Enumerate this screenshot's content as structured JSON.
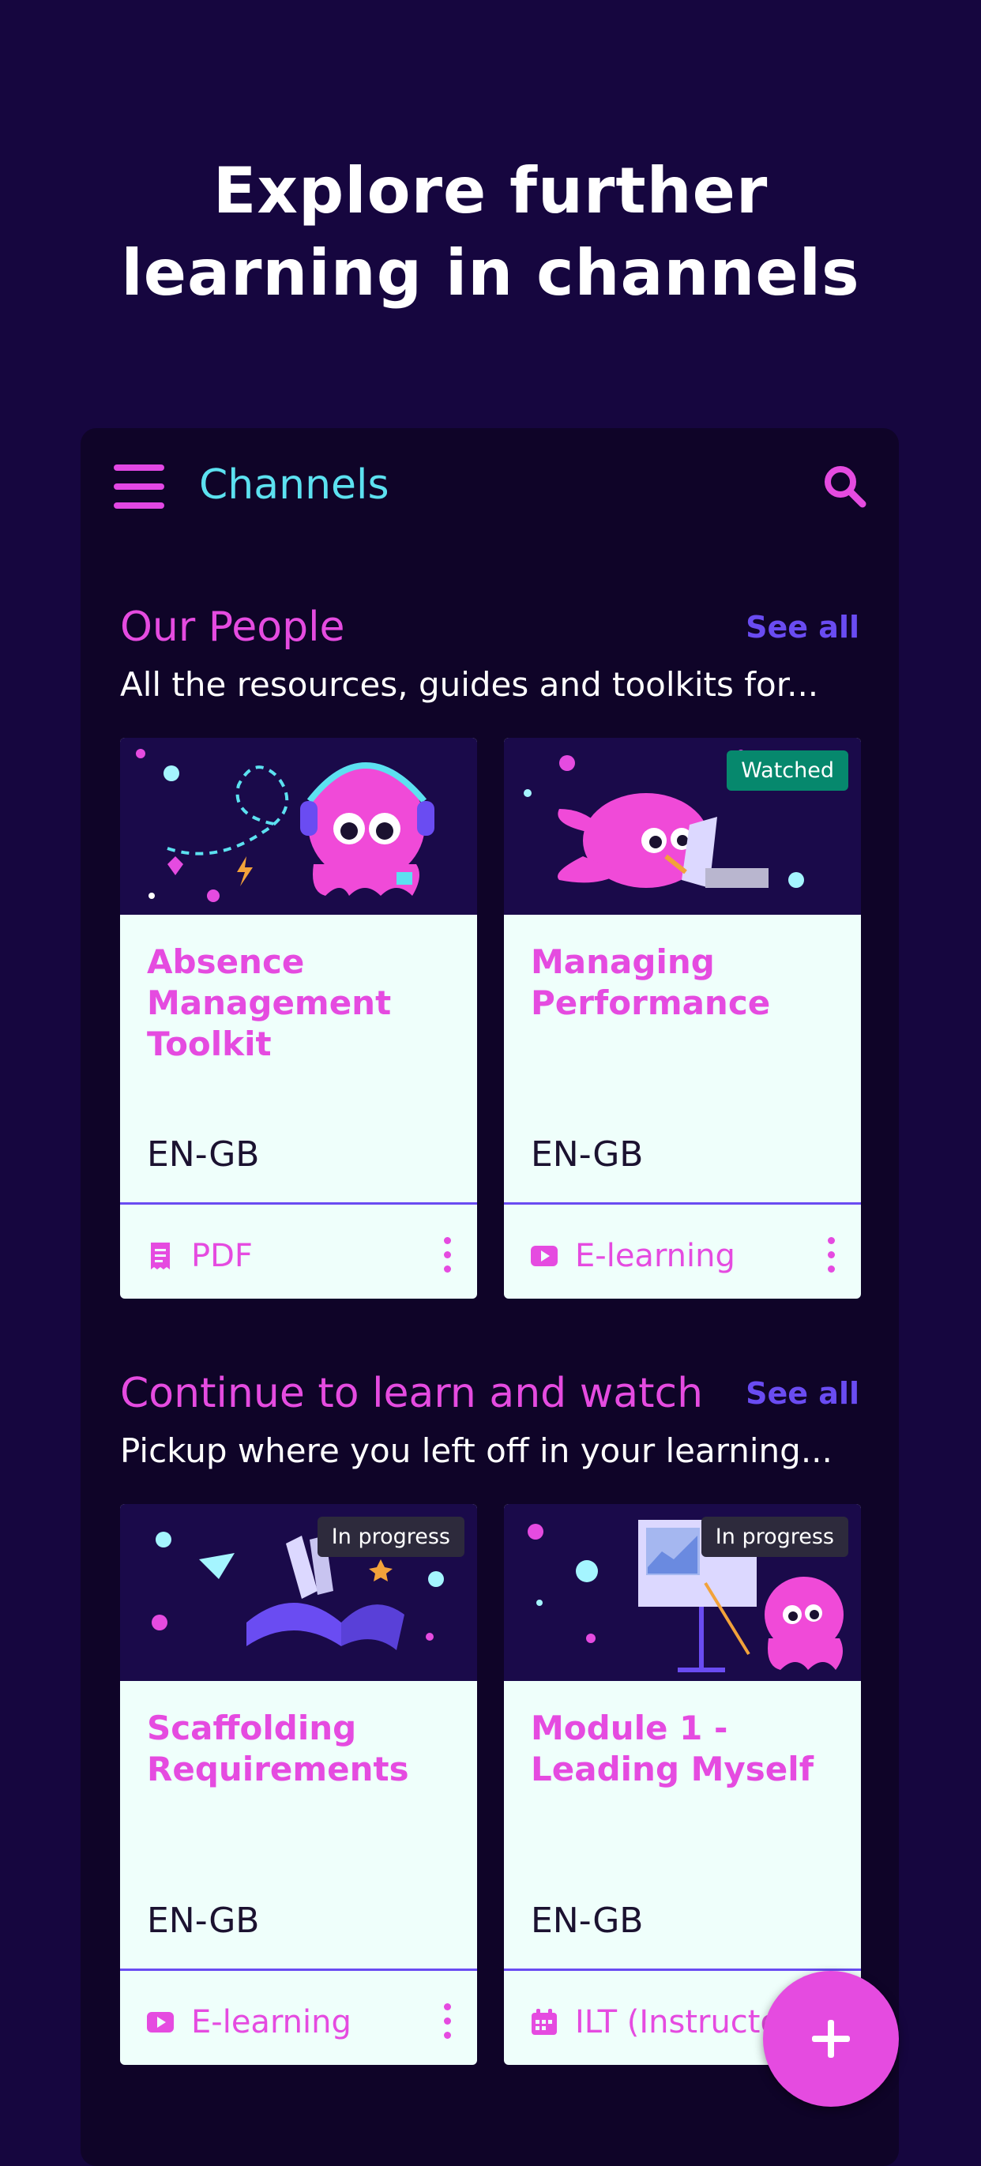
{
  "hero": {
    "line1": "Explore further",
    "line2": "learning in channels"
  },
  "appbar": {
    "title": "Channels",
    "menu_icon": "hamburger-menu-icon",
    "search_icon": "search-icon"
  },
  "sections": [
    {
      "title": "Our People",
      "see_all": "See all",
      "subtitle": "All the resources, guides and toolkits for...",
      "cards": [
        {
          "title": "Absence Management Toolkit",
          "lang": "EN-GB",
          "type": "PDF",
          "type_icon": "pdf-document-icon",
          "badge": ""
        },
        {
          "title": "Managing Performance",
          "lang": "EN-GB",
          "type": "E-learning",
          "type_icon": "play-video-icon",
          "badge": "Watched"
        }
      ]
    },
    {
      "title": "Continue to learn and watch",
      "see_all": "See all",
      "subtitle": "Pickup where you left off in your learning...",
      "cards": [
        {
          "title": "Scaffolding Requirements",
          "lang": "EN-GB",
          "type": "E-learning",
          "type_icon": "play-video-icon",
          "badge": "In progress"
        },
        {
          "title": "Module 1 - Leading Myself",
          "lang": "EN-GB",
          "type": "ILT (Instructo",
          "type_icon": "calendar-icon",
          "badge": "In progress"
        }
      ]
    }
  ],
  "colors": {
    "background": "#16063f",
    "panel": "#0f0428",
    "accent": "#e54be0",
    "title": "#5ce1f0",
    "link": "#6a4cf2",
    "card": "#effffb"
  }
}
